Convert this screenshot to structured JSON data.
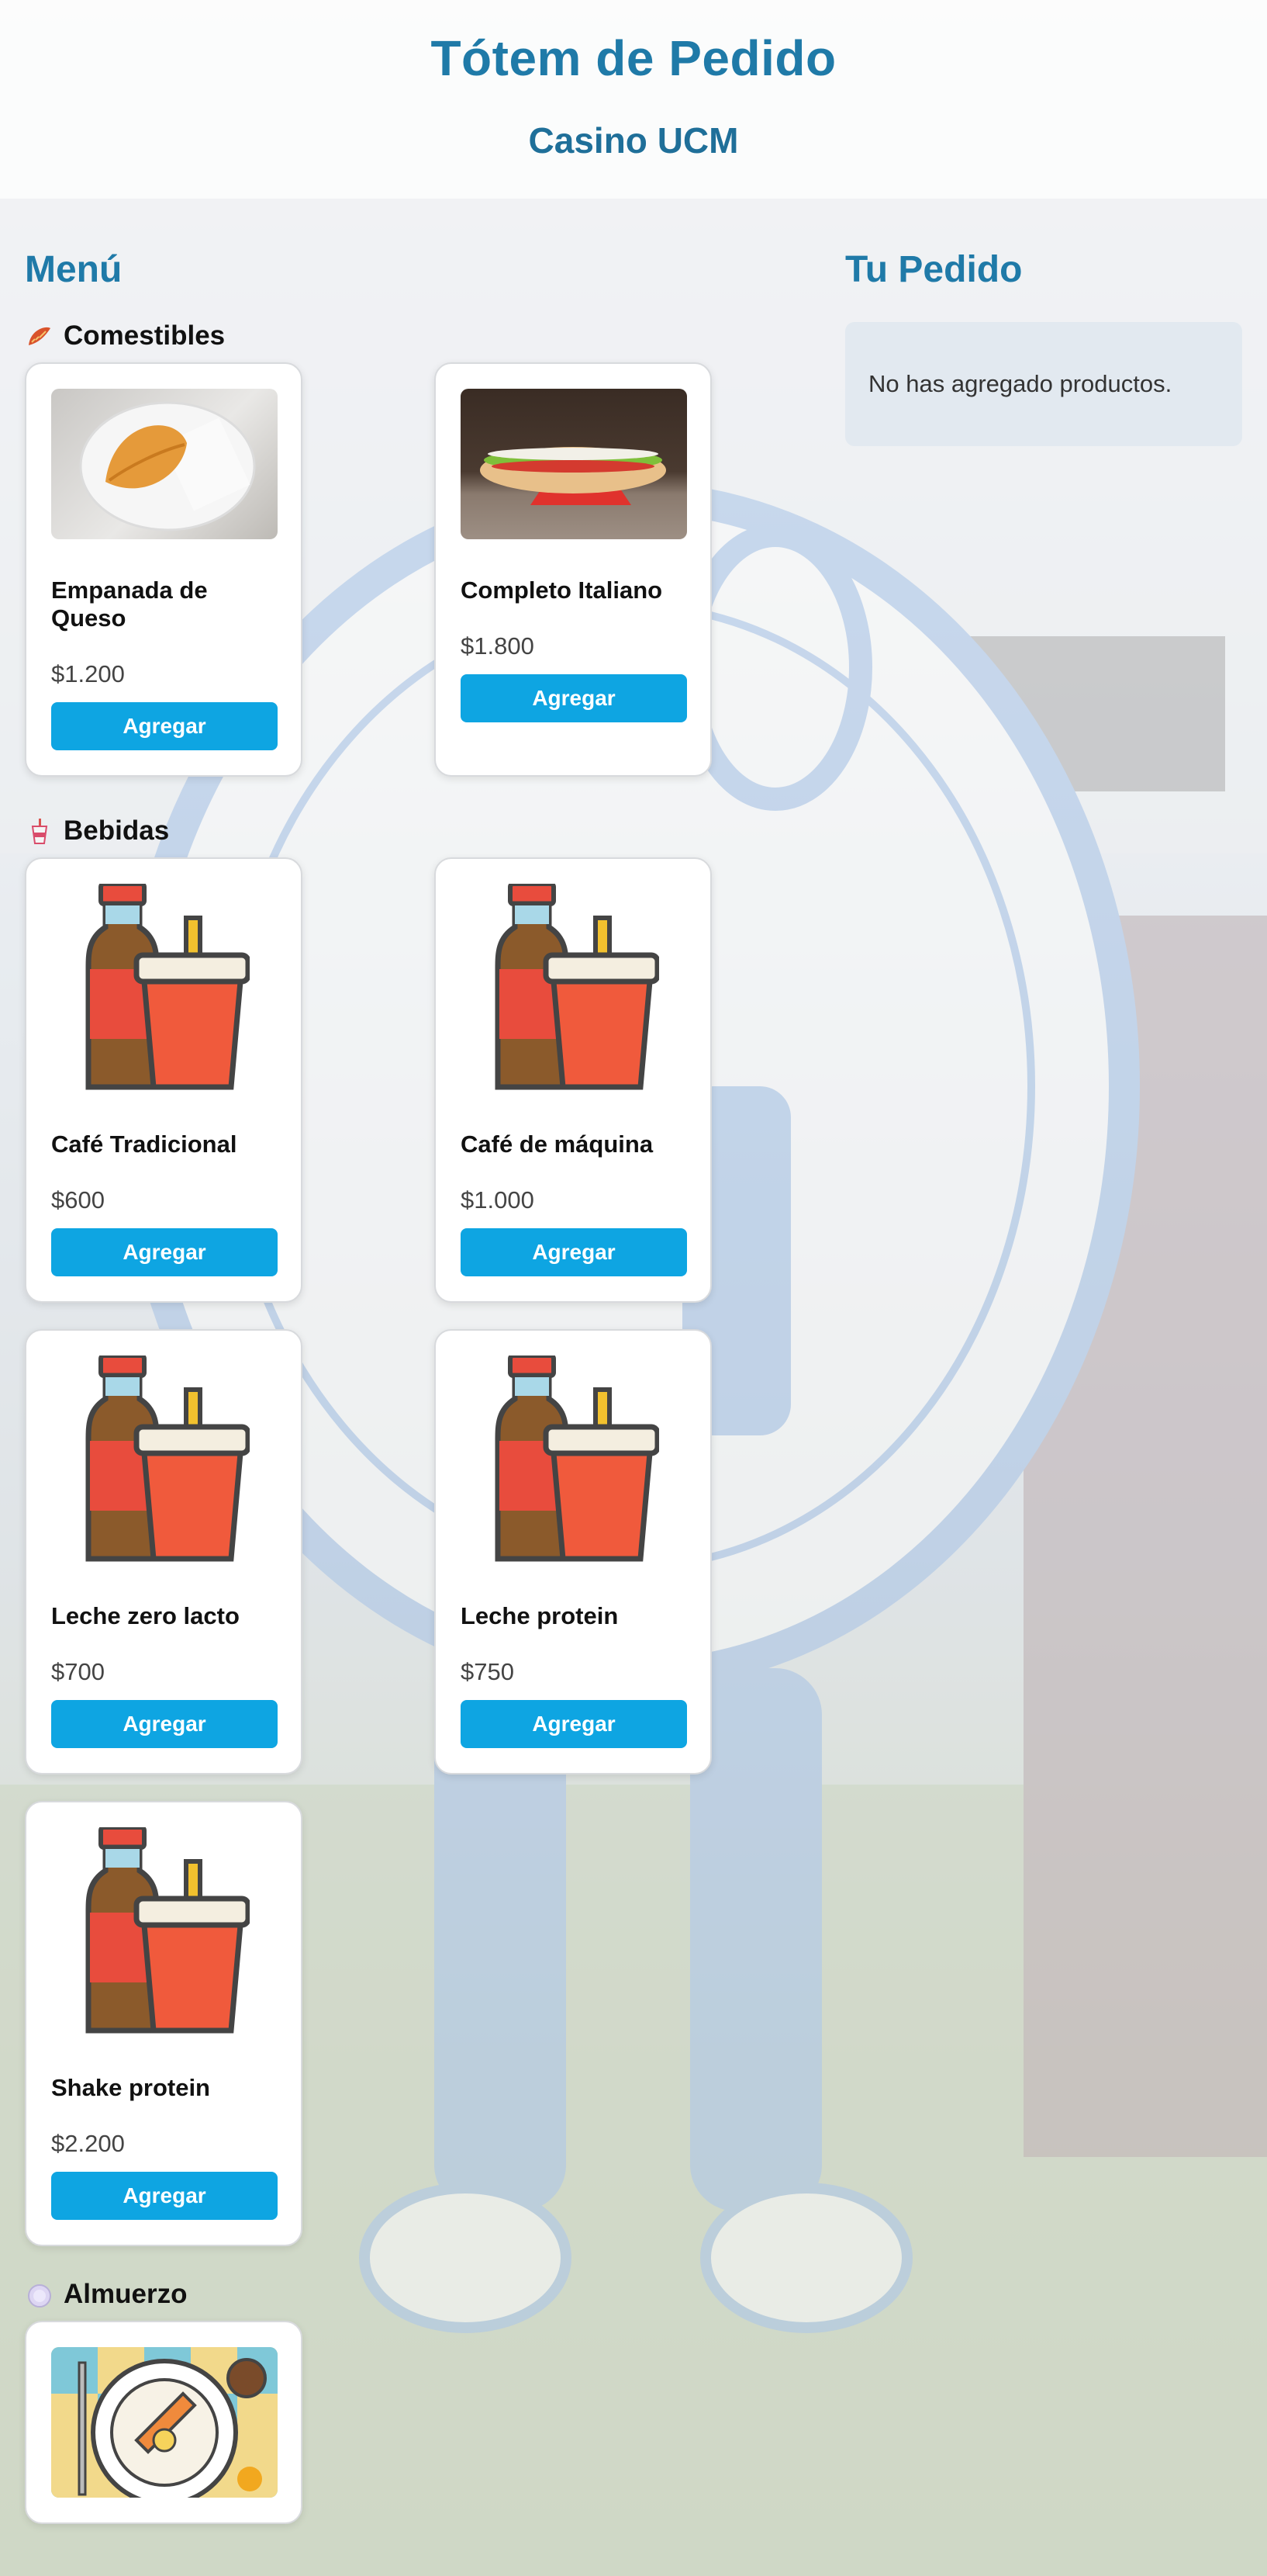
{
  "header": {
    "title": "Tótem de Pedido",
    "subtitle": "Casino UCM"
  },
  "menu": {
    "title": "Menú",
    "categories": [
      {
        "label": "Comestibles",
        "icon": "empanada-icon",
        "products": [
          {
            "name": "Empanada de Queso",
            "price": "$1.200",
            "button": "Agregar",
            "image": "empanada-photo"
          },
          {
            "name": "Completo Italiano",
            "price": "$1.800",
            "button": "Agregar",
            "image": "hotdog-photo"
          }
        ]
      },
      {
        "label": "Bebidas",
        "icon": "drink-icon",
        "products": [
          {
            "name": "Café Tradicional",
            "price": "$600",
            "button": "Agregar",
            "image": "drinks-icon"
          },
          {
            "name": "Café de máquina",
            "price": "$1.000",
            "button": "Agregar",
            "image": "drinks-icon"
          },
          {
            "name": "Leche zero lacto",
            "price": "$700",
            "button": "Agregar",
            "image": "drinks-icon"
          },
          {
            "name": "Leche protein",
            "price": "$750",
            "button": "Agregar",
            "image": "drinks-icon"
          },
          {
            "name": "Shake protein",
            "price": "$2.200",
            "button": "Agregar",
            "image": "drinks-icon"
          }
        ]
      },
      {
        "label": "Almuerzo",
        "icon": "plate-icon",
        "products": [
          {
            "name": "",
            "price": "",
            "button": "",
            "image": "lunch-plate-icon"
          }
        ]
      }
    ]
  },
  "order": {
    "title": "Tu Pedido",
    "empty_message": "No has agregado productos."
  },
  "colors": {
    "title_blue": "#1f7aa8",
    "button_blue": "#0ea5e2",
    "order_box": "#e2e9f0"
  }
}
